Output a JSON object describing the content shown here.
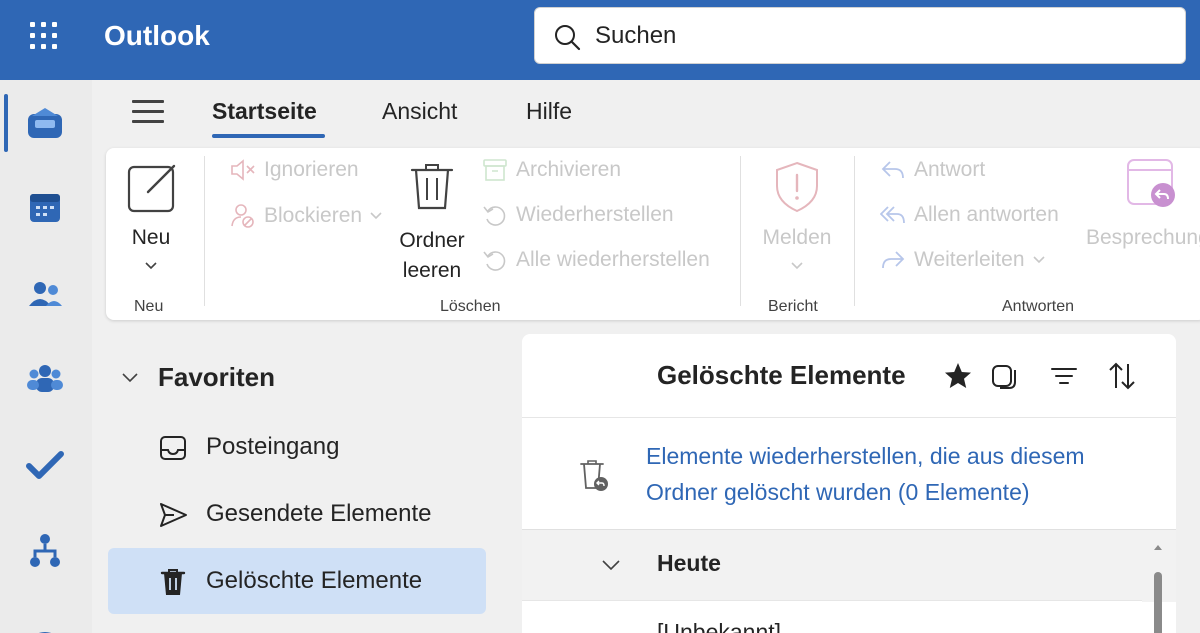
{
  "app": {
    "title": "Outlook"
  },
  "search": {
    "placeholder": "Suchen"
  },
  "rail": {
    "items": [
      "mail-icon",
      "calendar-icon",
      "people-icon",
      "groups-icon",
      "todo-icon",
      "org-explorer-icon"
    ]
  },
  "ribbon": {
    "tabs": [
      "Startseite",
      "Ansicht",
      "Hilfe"
    ],
    "active_tab": "Startseite",
    "new": {
      "label": "Neu",
      "group": "Neu"
    },
    "delete_group": {
      "ignore": "Ignorieren",
      "block": "Blockieren",
      "empty_folder_line1": "Ordner",
      "empty_folder_line2": "leeren",
      "archive": "Archivieren",
      "restore": "Wiederherstellen",
      "restore_all": "Alle wiederherstellen",
      "group": "Löschen"
    },
    "report": {
      "label": "Melden",
      "group": "Bericht"
    },
    "respond": {
      "reply": "Antwort",
      "reply_all": "Allen antworten",
      "forward": "Weiterleiten",
      "meeting": "Besprechung",
      "group": "Antworten"
    }
  },
  "folders": {
    "favorites_label": "Favoriten",
    "items": [
      {
        "label": "Posteingang",
        "icon": "inbox-icon",
        "selected": false
      },
      {
        "label": "Gesendete Elemente",
        "icon": "send-icon",
        "selected": false
      },
      {
        "label": "Gelöschte Elemente",
        "icon": "trash-icon",
        "selected": true
      }
    ]
  },
  "message_list": {
    "title": "Gelöschte Elemente",
    "restore_text": "Elemente wiederherstellen, die aus diesem Ordner gelöscht wurden (0 Elemente)",
    "group_label": "Heute",
    "first_sender": "[Unbekannt]"
  },
  "colors": {
    "accent": "#2f67b5",
    "selected_bg": "#cfe0f6",
    "disabled": "#c8c8c8"
  }
}
